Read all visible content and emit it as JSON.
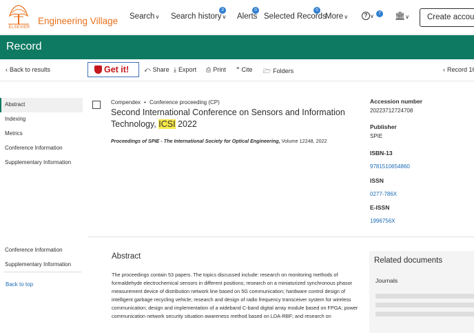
{
  "header": {
    "logo_text": "ELSEVIER",
    "brand": "Engineering Village",
    "nav": [
      {
        "label": "Search",
        "has_caret": true
      },
      {
        "label": "Search history",
        "has_caret": true,
        "badge": "3"
      },
      {
        "label": "Alerts",
        "badge": "0"
      },
      {
        "label": "Selected Records",
        "badge": "0"
      },
      {
        "label": "More",
        "has_caret": true
      }
    ],
    "help_icon": "help-circle-icon",
    "help_badge": "7",
    "institution_icon": "institution-icon",
    "create_account": "Create account"
  },
  "page_title": "Record",
  "toolbar": {
    "back": "Back to results",
    "getit": "Get it!",
    "share": "Share",
    "export": "Export",
    "print": "Print",
    "cite": "Cite",
    "folders": "Folders",
    "record_nav": "Record 16"
  },
  "sidebar": {
    "items": [
      "Abstract",
      "Indexing",
      "Metrics",
      "Conference Information",
      "Supplementary Information"
    ],
    "bottom_items": [
      "Conference Information",
      "Supplementary Information"
    ],
    "back_to_top": "Back to top"
  },
  "record": {
    "database": "Compendex",
    "doc_type": "Conference proceeding (CP)",
    "title_pre": "Second International Conference on Sensors and Information Technology, ",
    "title_highlight": "ICSI",
    "title_post": " 2022",
    "source_title": "Proceedings of SPIE - The International Society for Optical Engineering,",
    "source_rest": " Volume 12248, 2022"
  },
  "details": {
    "accession_label": "Accession number",
    "accession_value": "20223712724708",
    "publisher_label": "Publisher",
    "publisher_value": "SPIE",
    "isbn_label": "ISBN-13",
    "isbn_value": "9781510654860",
    "issn_label": "ISSN",
    "issn_value": "0277-786X",
    "eissn_label": "E-ISSN",
    "eissn_value": "1996756X"
  },
  "abstract": {
    "heading": "Abstract",
    "text": "The proceedings contain 53 papers. The topics discussed include: research on monitoring methods of formaldehyde electrochemical sensors in different positions; research on a miniaturized synchronous phasor measurement device of distribution network line based on 5G communication; hardware control design of intelligent garbage recycling vehicle; research and design of radio frequency transceiver system for wireless communication; design and implementation of a wideband C-band digital array module based on FPGA; power communication network security situation awareness method based on LDA-RBF; and research on"
  },
  "related": {
    "heading": "Related documents",
    "sub": "Journals"
  },
  "colors": {
    "brand_orange": "#e9711c",
    "header_green": "#0f7a62",
    "link_blue": "#1a6ab3",
    "getit_red": "#c4161c",
    "highlight_yellow": "#f7e84a"
  }
}
